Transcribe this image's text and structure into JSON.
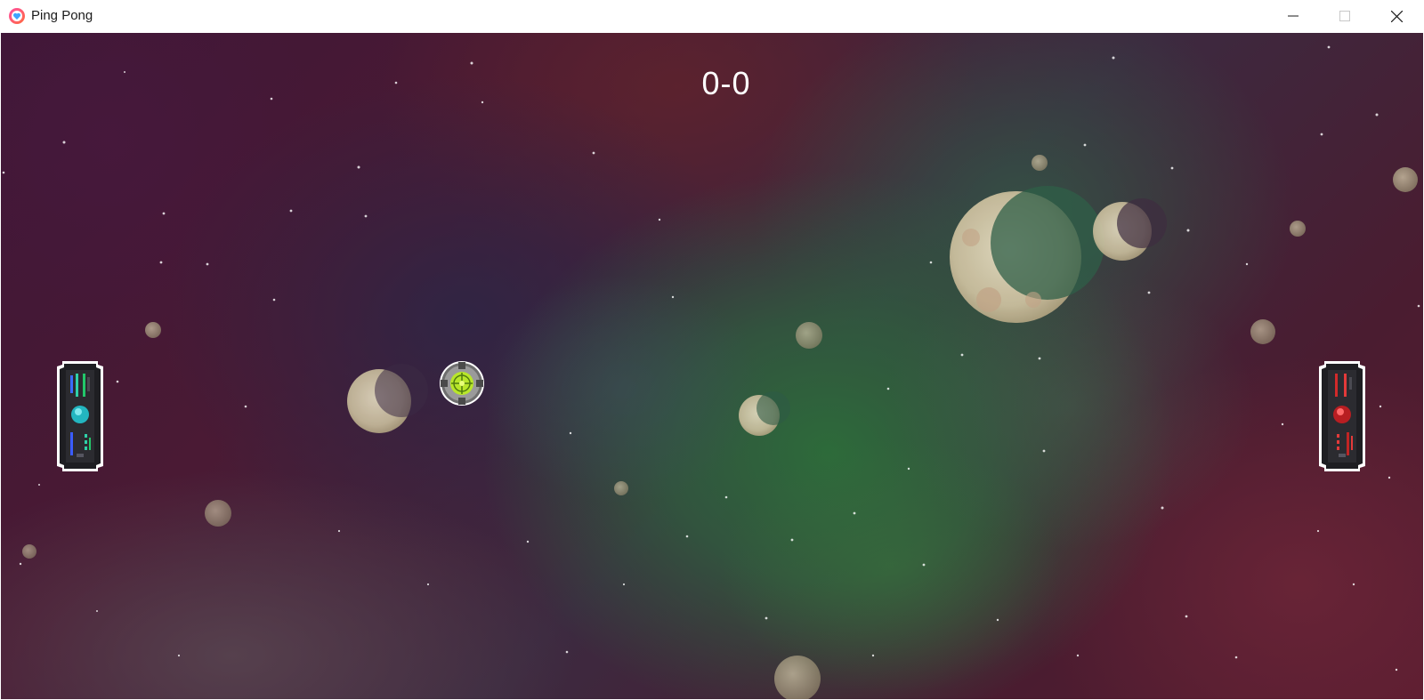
{
  "window": {
    "title": "Ping Pong",
    "app_icon": "heart-icon",
    "controls": {
      "minimize_icon": "minimize-icon",
      "maximize_icon": "maximize-icon",
      "close_icon": "close-icon"
    }
  },
  "game": {
    "score": "0-0",
    "background": "space-nebula",
    "paddles": {
      "left": {
        "icon": "blue-spaceship-paddle-icon",
        "accent": "#2bd0c0"
      },
      "right": {
        "icon": "red-spaceship-paddle-icon",
        "accent": "#d02828"
      }
    },
    "ball": {
      "icon": "green-orb-ball-icon",
      "accent": "#b8e62a"
    }
  },
  "colors": {
    "titlebar_bg": "#ffffff",
    "title_text": "#1b1b1b",
    "score_text": "#ffffff",
    "nebula_green": "#2e6e3e",
    "nebula_magenta": "#4a1a34"
  }
}
